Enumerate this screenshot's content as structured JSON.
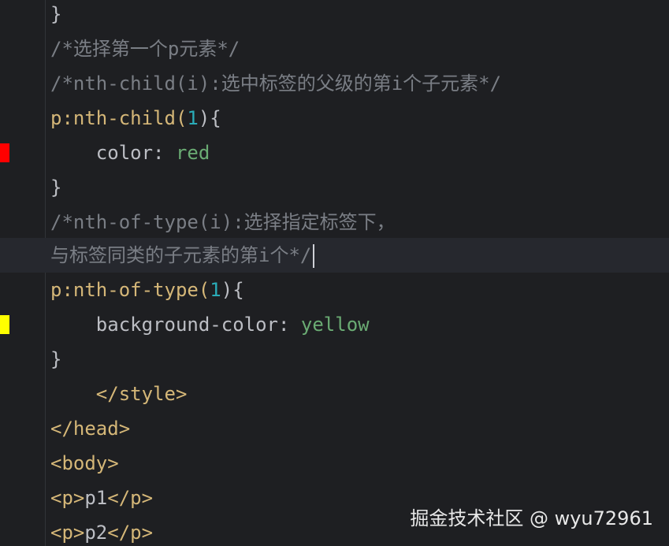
{
  "colors": {
    "background": "#1e1f22",
    "current_line": "#26282e",
    "comment": "#7a7e85",
    "selector": "#d5b778",
    "number": "#2aacb8",
    "property": "#bcbec4",
    "value": "#6aab73",
    "marker_red": "#ff0000",
    "marker_yellow": "#ffff00"
  },
  "editor": {
    "lines": {
      "l1": {
        "brace": "}"
      },
      "l2": {
        "comment": "/*选择第一个p元素*/"
      },
      "l3": {
        "comment": "/*nth-child(i):选中标签的父级的第i个子元素*/"
      },
      "l4": {
        "selector": "p:nth-child(",
        "num": "1",
        "close": "){"
      },
      "l5": {
        "indent": "    ",
        "prop": "color: ",
        "value": "red",
        "marker": "red-color-swatch"
      },
      "l6": {
        "brace": "}"
      },
      "l7": {
        "comment": "/*nth-of-type(i):选择指定标签下，"
      },
      "l8": {
        "comment": "与标签同类的子元素的第i个*/"
      },
      "l9": {
        "selector": "p:nth-of-type(",
        "num": "1",
        "close": "){"
      },
      "l10": {
        "indent": "    ",
        "prop": "background-color: ",
        "value": "yellow",
        "marker": "yellow-color-swatch"
      },
      "l11": {
        "brace": "}"
      },
      "l12": {
        "indent": "    ",
        "tag": "</style>"
      },
      "l13": {
        "tag": "</head>"
      },
      "l14": {
        "tag": "<body>"
      },
      "l15": {
        "open": "<p>",
        "text": "p1",
        "close": "</p>"
      },
      "l16": {
        "open": "<p>",
        "text": "p2",
        "close": "</p>"
      }
    }
  },
  "watermark": {
    "text": "掘金技术社区 @ wyu72961"
  }
}
